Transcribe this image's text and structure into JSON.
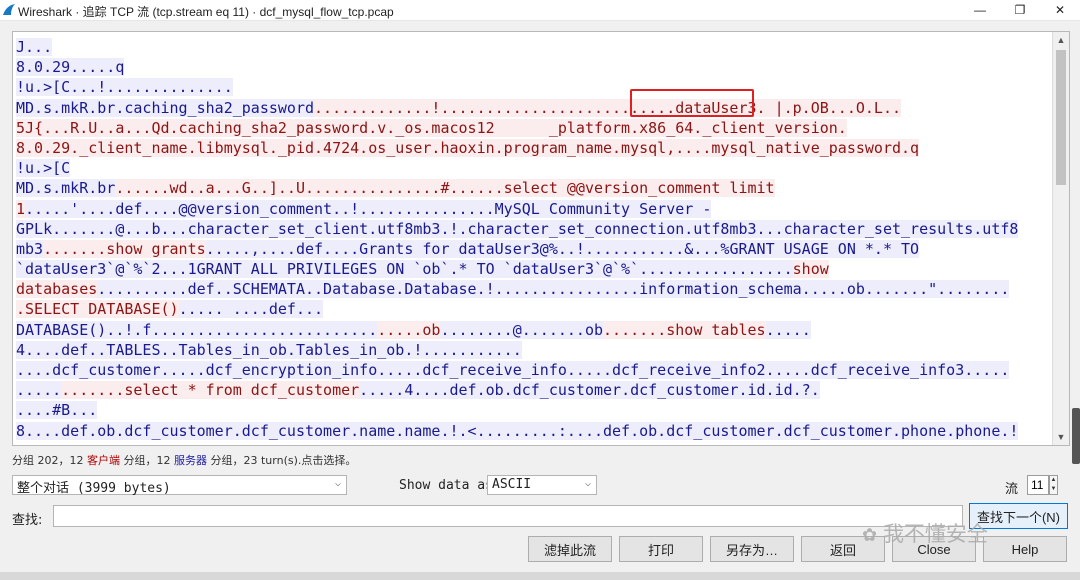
{
  "window": {
    "title": "Wireshark · 追踪 TCP 流 (tcp.stream eq 11) · dcf_mysql_flow_tcp.pcap",
    "minimize": "—",
    "restore": "❐",
    "close": "✕"
  },
  "stream": {
    "lines": [
      {
        "segs": [
          {
            "t": "J...",
            "c": "server"
          }
        ]
      },
      {
        "segs": [
          {
            "t": "8.0.29.....q",
            "c": "server"
          }
        ]
      },
      {
        "segs": [
          {
            "t": "!u.>[C...!..............",
            "c": "server"
          }
        ]
      },
      {
        "segs": [
          {
            "t": "MD.s.mkR.br.caching_sha2_password",
            "c": "server"
          },
          {
            "t": ".............!..........................dataUser3. |.p.OB...O.L..",
            "c": "client"
          }
        ]
      },
      {
        "segs": [
          {
            "t": "5J{...R.U..a...Qd.caching_sha2_password.v._os.macos12      _platform.x86_64._client_version.",
            "c": "client"
          }
        ]
      },
      {
        "segs": [
          {
            "t": "8.0.29._client_name.libmysql._pid.4724.os_user.haoxin.program_name.mysql,....mysql_native_password.q",
            "c": "client"
          }
        ]
      },
      {
        "segs": [
          {
            "t": "!u.>[C",
            "c": "server"
          }
        ]
      },
      {
        "segs": [
          {
            "t": "MD.s.mkR.br",
            "c": "server"
          },
          {
            "t": "......wd..a...G..]..U...............#......select @@version_comment limit",
            "c": "client"
          }
        ]
      },
      {
        "segs": [
          {
            "t": "1",
            "c": "client"
          },
          {
            "t": ".....'....def....@@version_comment..!...............MySQL Community Server -",
            "c": "server"
          }
        ]
      },
      {
        "segs": [
          {
            "t": "GPLk.......@...b...character_set_client.utf8mb3.!.character_set_connection.utf8mb3...character_set_results.utf8",
            "c": "server"
          }
        ]
      },
      {
        "segs": [
          {
            "t": "mb3",
            "c": "server"
          },
          {
            "t": ".......show grants",
            "c": "client"
          },
          {
            "t": ".....,....def....Grants for dataUser3@%..!...........&...%GRANT USAGE ON *.* TO",
            "c": "server"
          }
        ]
      },
      {
        "segs": [
          {
            "t": "`dataUser3`@`%`2...1GRANT ALL PRIVILEGES ON `ob`.* TO `dataUser3`@`%`.................",
            "c": "server"
          },
          {
            "t": "show",
            "c": "client"
          }
        ]
      },
      {
        "segs": [
          {
            "t": "databases",
            "c": "client"
          },
          {
            "t": "..........def..SCHEMATA..Database.Database.!................information_schema.....ob.......\"........",
            "c": "server"
          }
        ]
      },
      {
        "segs": [
          {
            "t": ".SELECT DATABASE()",
            "c": "client"
          },
          {
            "t": "..... ....def...",
            "c": "server"
          }
        ]
      },
      {
        "segs": [
          {
            "t": "DATABASE()..!.f.........................",
            "c": "server"
          },
          {
            "t": ".....ob",
            "c": "client"
          },
          {
            "t": "........@.......ob",
            "c": "server"
          },
          {
            "t": ".......show tables",
            "c": "client"
          },
          {
            "t": ".....",
            "c": "server"
          }
        ]
      },
      {
        "segs": [
          {
            "t": "4....def..TABLES..Tables_in_ob.Tables_in_ob.!...........",
            "c": "server"
          }
        ]
      },
      {
        "segs": [
          {
            "t": "....dcf_customer.....dcf_encryption_info.....dcf_receive_info.....dcf_receive_info2.....dcf_receive_info3.....",
            "c": "server"
          }
        ]
      },
      {
        "segs": [
          {
            "t": ".....",
            "c": "server"
          },
          {
            "t": ".......select * from dcf_customer",
            "c": "client"
          },
          {
            "t": ".....4....def.ob.dcf_customer.dcf_customer.id.id.?.",
            "c": "server"
          }
        ]
      },
      {
        "segs": [
          {
            "t": "....#B...",
            "c": "server"
          }
        ]
      },
      {
        "segs": [
          {
            "t": "8....def.ob.dcf_customer.dcf_customer.name.name.!.<.........:....def.ob.dcf_customer.dcf_customer.phone.phone.!",
            "c": "server"
          }
        ]
      }
    ]
  },
  "status": {
    "part1": "分组 202，12 ",
    "client_label": "客户端",
    "part2": " 分组，12 ",
    "server_label": "服务器",
    "part3": " 分组，23 turn(s).点击选择。"
  },
  "controls": {
    "conversation_select": "整个对话 (3999 bytes)",
    "show_data_label": "Show data as",
    "show_data_select": "ASCII",
    "stream_label": "流",
    "stream_value": "11",
    "find_label": "查找:",
    "find_value": "",
    "find_next": "查找下一个(N)",
    "filter_out": "滤掉此流",
    "print": "打印",
    "save_as": "另存为…",
    "back": "返回",
    "close": "Close",
    "help": "Help"
  },
  "watermark": "我不懂安全",
  "colors": {
    "client_bg": "#fbeded",
    "client_fg": "#8b1414",
    "server_bg": "#ededfb",
    "server_fg": "#1a1a8c",
    "highlight_box": "#e02020"
  }
}
